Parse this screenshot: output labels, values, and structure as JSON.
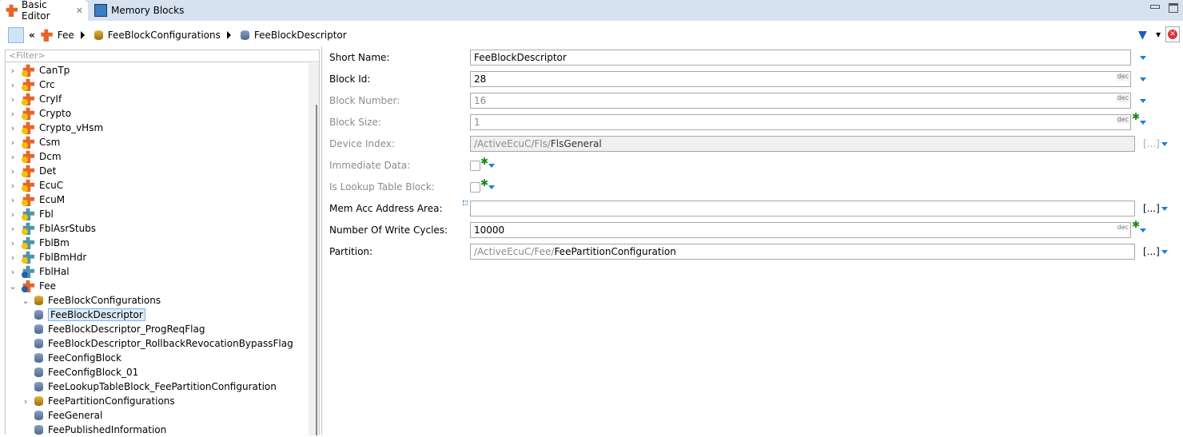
{
  "tabs": [
    {
      "label": "Basic Editor",
      "active": true
    },
    {
      "label": "Memory Blocks",
      "active": false
    }
  ],
  "breadcrumb": [
    "Fee",
    "FeeBlockConfigurations",
    "FeeBlockDescriptor"
  ],
  "tree": {
    "filter_placeholder": "<Filter>",
    "items": [
      {
        "label": "CanTp",
        "icon": "module-warning"
      },
      {
        "label": "Crc",
        "icon": "module-warning"
      },
      {
        "label": "CryIf",
        "icon": "module-warning"
      },
      {
        "label": "Crypto",
        "icon": "module-warning"
      },
      {
        "label": "Crypto_vHsm",
        "icon": "module-warning"
      },
      {
        "label": "Csm",
        "icon": "module-warning"
      },
      {
        "label": "Dcm",
        "icon": "module-warning"
      },
      {
        "label": "Det",
        "icon": "module-warning"
      },
      {
        "label": "EcuC",
        "icon": "module-warning"
      },
      {
        "label": "EcuM",
        "icon": "module-warning"
      },
      {
        "label": "Fbl",
        "icon": "module-teal"
      },
      {
        "label": "FblAsrStubs",
        "icon": "module-teal"
      },
      {
        "label": "FblBm",
        "icon": "module-teal"
      },
      {
        "label": "FblBmHdr",
        "icon": "module-teal"
      },
      {
        "label": "FblHal",
        "icon": "module-teal-info"
      },
      {
        "label": "Fee",
        "icon": "module-info",
        "expanded": true
      },
      {
        "label": "FeeBlockConfigurations",
        "icon": "container",
        "expanded": true
      },
      {
        "label": "FeeBlockDescriptor",
        "icon": "block",
        "selected": true
      },
      {
        "label": "FeeBlockDescriptor_ProgReqFlag",
        "icon": "block"
      },
      {
        "label": "FeeBlockDescriptor_RollbackRevocationBypassFlag",
        "icon": "block"
      },
      {
        "label": "FeeConfigBlock",
        "icon": "block"
      },
      {
        "label": "FeeConfigBlock_01",
        "icon": "block"
      },
      {
        "label": "FeeLookupTableBlock_FeePartitionConfiguration",
        "icon": "block"
      },
      {
        "label": "FeePartitionConfigurations",
        "icon": "container-info"
      },
      {
        "label": "FeeGeneral",
        "icon": "block"
      },
      {
        "label": "FeePublishedInformation",
        "icon": "block"
      }
    ]
  },
  "form": {
    "short_name": {
      "label": "Short Name:",
      "value": "FeeBlockDescriptor"
    },
    "block_id": {
      "label": "Block Id:",
      "value": "28",
      "unit": "dec"
    },
    "block_number": {
      "label": "Block Number:",
      "value": "16",
      "unit": "dec"
    },
    "block_size": {
      "label": "Block Size:",
      "value": "1",
      "unit": "dec"
    },
    "device_index": {
      "label": "Device Index:",
      "prefix": "/ActiveEcuC/Fls/",
      "value": "FlsGeneral",
      "browse": "[...]"
    },
    "immediate_data": {
      "label": "Immediate Data:",
      "checked": false
    },
    "is_lookup": {
      "label": "Is Lookup Table Block:",
      "checked": false
    },
    "mem_acc": {
      "label": "Mem Acc Address Area:",
      "value": "",
      "browse": "[...]"
    },
    "write_cycles": {
      "label": "Number Of Write Cycles:",
      "value": "10000",
      "unit": "dec"
    },
    "partition": {
      "label": "Partition:",
      "prefix": "/ActiveEcuC/Fee/",
      "value": "FeePartitionConfiguration",
      "browse": "[...]"
    }
  },
  "colors": {
    "accent": "#1a7fd6",
    "tab_bar": "#d6e2f0",
    "selection": "#dbeaf8"
  }
}
